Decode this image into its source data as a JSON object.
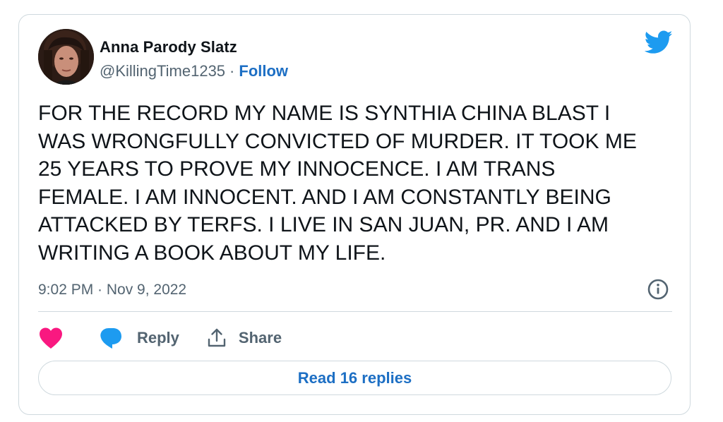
{
  "tweet": {
    "author": {
      "display_name": "Anna Parody Slatz",
      "handle": "@KillingTime1235",
      "separator": "·",
      "follow_label": "Follow",
      "avatar_icon": "profile-photo"
    },
    "brand_icon": "twitter-bird-icon",
    "text": "FOR THE RECORD MY NAME IS SYNTHIA CHINA BLAST I\nWAS WRONGFULLY CONVICTED OF MURDER. IT TOOK ME\n25 YEARS TO PROVE MY INNOCENCE. I AM TRANS\nFEMALE. I AM INNOCENT. AND I AM CONSTANTLY BEING\nATTACKED BY TERFS. I LIVE IN SAN JUAN, PR. AND I AM\nWRITING A BOOK ABOUT MY LIFE.",
    "timestamp": "9:02 PM · Nov 9, 2022",
    "info_icon": "info-icon",
    "actions": {
      "like_icon": "heart-icon",
      "reply_label": "Reply",
      "reply_icon": "speech-bubble-icon",
      "share_label": "Share",
      "share_icon": "share-upload-icon"
    },
    "read_replies_label": "Read 16 replies"
  },
  "colors": {
    "link_blue": "#1d6fc4",
    "twitter_blue": "#1d9bf0",
    "heart_pink": "#f91880",
    "muted_text": "#536471",
    "border": "#cfd9de"
  }
}
